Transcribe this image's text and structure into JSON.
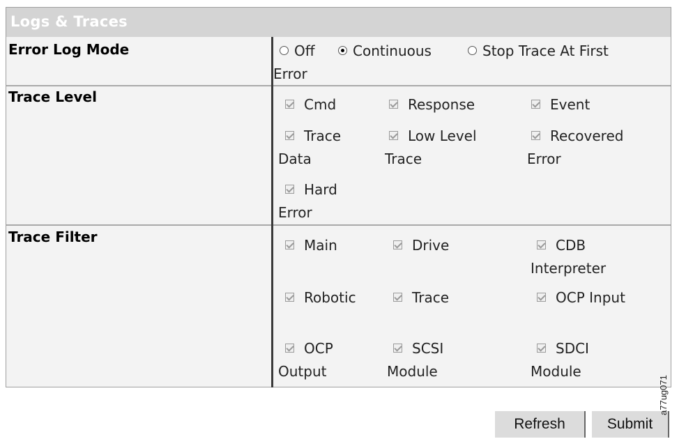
{
  "panel": {
    "title": "Logs & Traces"
  },
  "error_log_mode": {
    "label": "Error Log Mode",
    "options": [
      {
        "label": "Off",
        "selected": false
      },
      {
        "label": "Continuous",
        "selected": true
      },
      {
        "label": "Stop Trace At First",
        "label2": "Error",
        "selected": false
      }
    ]
  },
  "trace_level": {
    "label": "Trace Level",
    "items": [
      {
        "line1": "Cmd",
        "checked": true
      },
      {
        "line1": "Response",
        "checked": true
      },
      {
        "line1": "Event",
        "checked": true
      },
      {
        "line1": "Trace",
        "line2": "Data",
        "checked": true
      },
      {
        "line1": "Low Level",
        "line2": "Trace",
        "checked": true
      },
      {
        "line1": "Recovered",
        "line2": "Error",
        "checked": true
      },
      {
        "line1": "Hard",
        "line2": "Error",
        "checked": true
      }
    ]
  },
  "trace_filter": {
    "label": "Trace Filter",
    "items": [
      {
        "line1": "Main",
        "checked": true
      },
      {
        "line1": "Drive",
        "checked": true
      },
      {
        "line1": "CDB",
        "line2": "Interpreter",
        "checked": true
      },
      {
        "line1": "Robotic",
        "checked": true
      },
      {
        "line1": "Trace",
        "checked": true
      },
      {
        "line1": "OCP Input",
        "checked": true
      },
      {
        "line1": "OCP",
        "line2": "Output",
        "checked": true
      },
      {
        "line1": "SCSI",
        "line2": "Module",
        "checked": true
      },
      {
        "line1": "SDCI",
        "line2": "Module",
        "checked": true
      }
    ]
  },
  "buttons": {
    "refresh": "Refresh",
    "submit": "Submit"
  },
  "figure_id": "a77ug071"
}
